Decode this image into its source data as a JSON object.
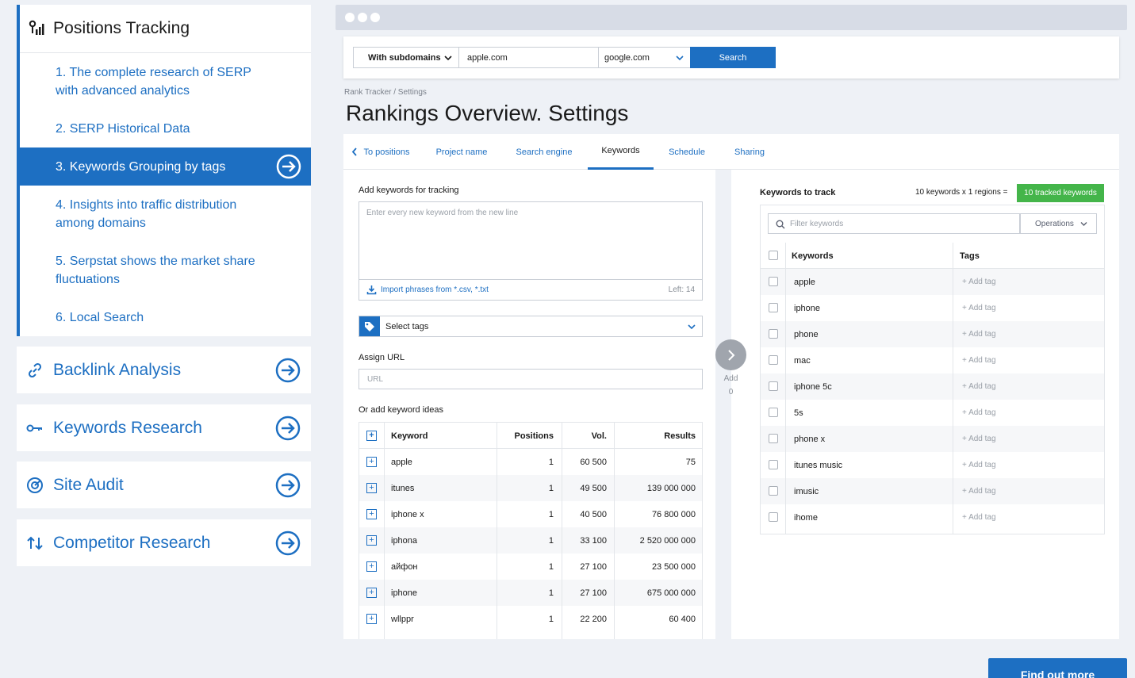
{
  "sidebar": {
    "title": "Positions Tracking",
    "items": [
      {
        "label": "1. The complete research of SERP with advanced analytics"
      },
      {
        "label": "2. SERP Historical Data"
      },
      {
        "label": "3. Keywords Grouping by tags"
      },
      {
        "label": "4. Insights into traffic distribution among domains"
      },
      {
        "label": "5. Serpstat shows the market share fluctuations"
      },
      {
        "label": "6. Local Search"
      }
    ],
    "sections": [
      {
        "label": "Backlink Analysis",
        "icon": "link-icon"
      },
      {
        "label": "Keywords Research",
        "icon": "key-icon"
      },
      {
        "label": "Site Audit",
        "icon": "audit-icon"
      },
      {
        "label": "Competitor Research",
        "icon": "arrows-updown-icon"
      }
    ]
  },
  "search": {
    "subdomains": "With subdomains",
    "domain": "apple.com",
    "engine": "google.com",
    "button": "Search"
  },
  "breadcrumb": "Rank Tracker / Settings",
  "page_title": "Rankings Overview. Settings",
  "tabs": [
    {
      "label": "To positions"
    },
    {
      "label": "Project name"
    },
    {
      "label": "Search engine"
    },
    {
      "label": "Keywords"
    },
    {
      "label": "Schedule"
    },
    {
      "label": "Sharing"
    }
  ],
  "add_keywords": {
    "label": "Add keywords for tracking",
    "placeholder": "Enter every new keyword from the new line",
    "import": "Import phrases from *.csv, *.txt",
    "left": "Left: 14",
    "select_tags": "Select tags",
    "assign_url_label": "Assign URL",
    "url_placeholder": "URL",
    "ideas_label": "Or add keyword ideas"
  },
  "ideas": {
    "headers": [
      "Keyword",
      "Positions",
      "Vol.",
      "Results"
    ],
    "rows": [
      {
        "keyword": "apple",
        "positions": "1",
        "vol": "60 500",
        "results": "75"
      },
      {
        "keyword": "itunes",
        "positions": "1",
        "vol": "49 500",
        "results": "139 000 000"
      },
      {
        "keyword": "iphone x",
        "positions": "1",
        "vol": "40 500",
        "results": "76 800 000"
      },
      {
        "keyword": "iphona",
        "positions": "1",
        "vol": "33 100",
        "results": "2 520 000 000"
      },
      {
        "keyword": "айфон",
        "positions": "1",
        "vol": "27 100",
        "results": "23 500 000"
      },
      {
        "keyword": "iphone",
        "positions": "1",
        "vol": "27 100",
        "results": "675 000 000"
      },
      {
        "keyword": "wllppr",
        "positions": "1",
        "vol": "22 200",
        "results": "60 400"
      }
    ]
  },
  "add": {
    "label": "Add",
    "count": "0"
  },
  "tracking": {
    "title": "Keywords to track",
    "summary": "10 keywords x 1 regions =",
    "badge": "10 tracked keywords",
    "filter_placeholder": "Filter keywords",
    "operations": "Operations",
    "headers": [
      "Keywords",
      "Tags"
    ],
    "add_tag": "+ Add tag",
    "rows": [
      "apple",
      "iphone",
      "phone",
      "mac",
      "iphone 5c",
      "5s",
      "phone x",
      "itunes music",
      "imusic",
      "ihome"
    ]
  },
  "cta": "Find out more",
  "colors": {
    "accent": "#1d6fc2",
    "badge": "#44b54a"
  }
}
